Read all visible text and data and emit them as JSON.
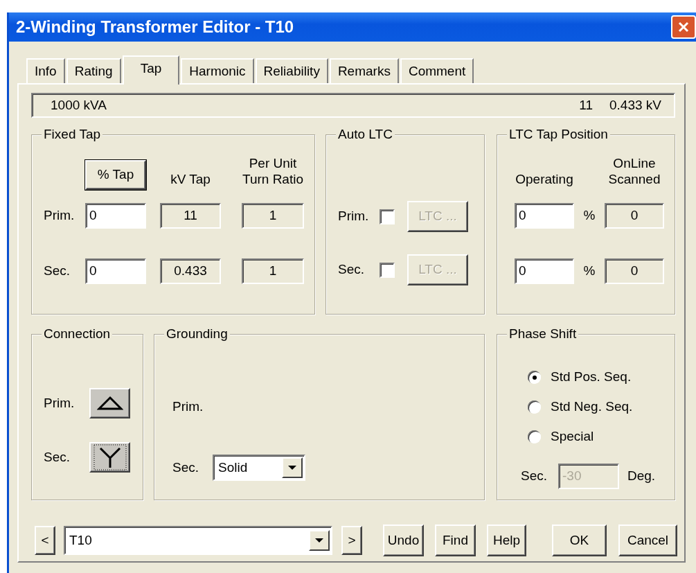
{
  "window": {
    "title": "2-Winding Transformer Editor - T10"
  },
  "tabs": [
    {
      "label": "Info",
      "selected": false
    },
    {
      "label": "Rating",
      "selected": false
    },
    {
      "label": "Tap",
      "selected": true
    },
    {
      "label": "Harmonic",
      "selected": false
    },
    {
      "label": "Reliability",
      "selected": false
    },
    {
      "label": "Remarks",
      "selected": false
    },
    {
      "label": "Comment",
      "selected": false
    }
  ],
  "summary": {
    "rating": "1000 kVA",
    "primary_kv": "11",
    "secondary_kv": "0.433 kV"
  },
  "fixed_tap": {
    "title": "Fixed Tap",
    "mode_button": "% Tap",
    "kv_header": "kV Tap",
    "ratio_header": "Per Unit\nTurn Ratio",
    "rows": [
      {
        "label": "Prim.",
        "tap": "0",
        "kv": "11",
        "ratio": "1"
      },
      {
        "label": "Sec.",
        "tap": "0",
        "kv": "0.433",
        "ratio": "1"
      }
    ]
  },
  "auto_ltc": {
    "title": "Auto LTC",
    "rows": [
      {
        "label": "Prim.",
        "checked": false,
        "button": "LTC ...",
        "disabled": true
      },
      {
        "label": "Sec.",
        "checked": false,
        "button": "LTC ...",
        "disabled": true
      }
    ]
  },
  "ltc_tap_position": {
    "title": "LTC Tap Position",
    "operating_header": "Operating",
    "scanned_header": "OnLine\nScanned",
    "rows": [
      {
        "operating": "0",
        "unit": "%",
        "scanned": "0"
      },
      {
        "operating": "0",
        "unit": "%",
        "scanned": "0"
      }
    ]
  },
  "connection": {
    "title": "Connection",
    "rows": [
      {
        "label": "Prim.",
        "kind": "delta"
      },
      {
        "label": "Sec.",
        "kind": "wye"
      }
    ]
  },
  "grounding": {
    "title": "Grounding",
    "rows": [
      {
        "label": "Prim."
      },
      {
        "label": "Sec.",
        "value": "Solid"
      }
    ]
  },
  "phase_shift": {
    "title": "Phase Shift",
    "options": [
      {
        "label": "Std Pos. Seq.",
        "selected": true
      },
      {
        "label": "Std Neg. Seq.",
        "selected": false
      },
      {
        "label": "Special",
        "selected": false
      }
    ],
    "sec_label": "Sec.",
    "sec_value": "-30",
    "sec_disabled": true,
    "unit": "Deg."
  },
  "footer": {
    "prev": "<",
    "next": ">",
    "element": "T10",
    "buttons": [
      "Undo",
      "Find",
      "Help",
      "OK",
      "Cancel"
    ]
  }
}
